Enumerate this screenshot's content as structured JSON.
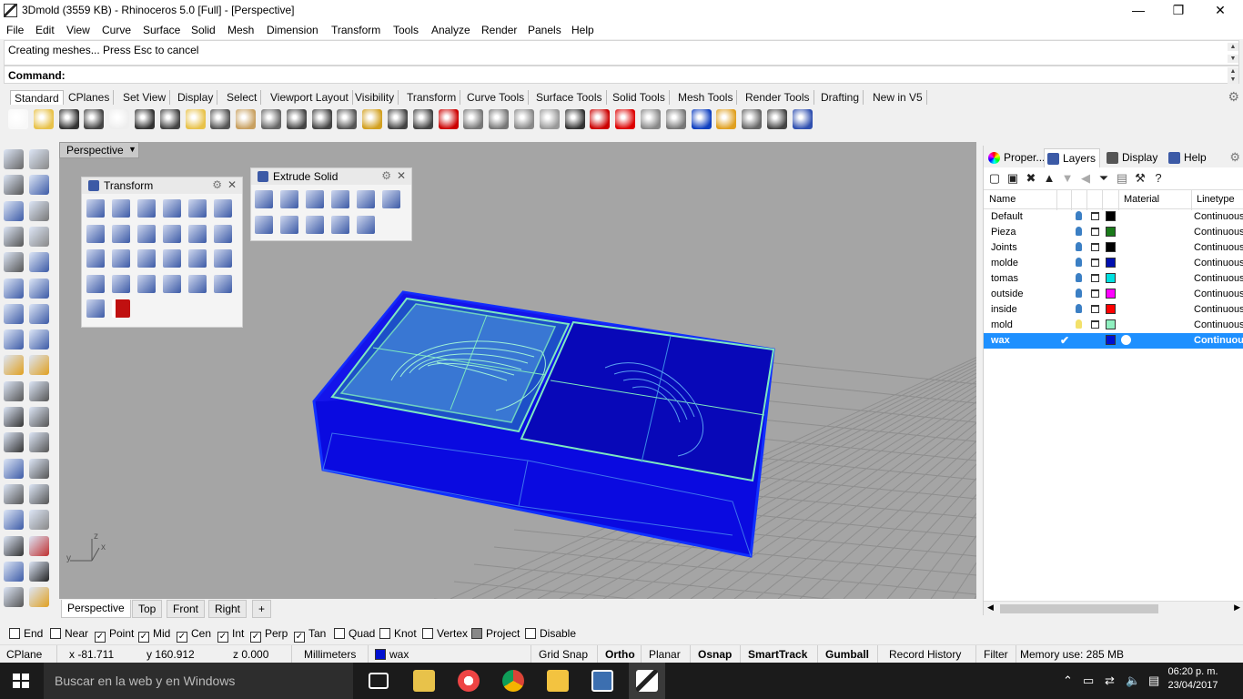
{
  "window": {
    "title": "3Dmold (3559 KB) - Rhinoceros 5.0 [Full] - [Perspective]",
    "minimize_glyph": "—",
    "restore_glyph": "❐",
    "close_glyph": "✕"
  },
  "menu": [
    "File",
    "Edit",
    "View",
    "Curve",
    "Surface",
    "Solid",
    "Mesh",
    "Dimension",
    "Transform",
    "Tools",
    "Analyze",
    "Render",
    "Panels",
    "Help"
  ],
  "command": {
    "history": "Creating meshes... Press Esc to cancel",
    "prompt": "Command:"
  },
  "toolbar_tabs": [
    "Standard",
    "CPlanes",
    "Set View",
    "Display",
    "Select",
    "Viewport Layout",
    "Visibility",
    "Transform",
    "Curve Tools",
    "Surface Tools",
    "Solid Tools",
    "Mesh Tools",
    "Render Tools",
    "Drafting",
    "New in V5"
  ],
  "standard_icons": [
    "new-icon",
    "open-icon",
    "save-icon",
    "print-icon",
    "import-icon",
    "cut-icon",
    "copy-icon",
    "paste-icon",
    "undo-icon",
    "pan-icon",
    "move-view-icon",
    "zoom-icon",
    "zoom-window-icon",
    "zoom-extents-icon",
    "zoom-selected-icon",
    "rotate-view-icon",
    "four-views-icon",
    "car-icon",
    "cplane-icon",
    "snap-icon",
    "points-icon",
    "light-icon",
    "lock-icon",
    "layer-color-icon",
    "color-wheel-icon",
    "shaded-sphere-icon",
    "rendered-sphere-icon",
    "blue-sphere-icon",
    "render-icon",
    "settings-icon",
    "options-icon",
    "help-icon"
  ],
  "viewport": {
    "name": "Perspective",
    "dropdown": "▼",
    "axes": {
      "x": "x",
      "y": "y",
      "z": "z"
    }
  },
  "transform_panel": {
    "title": "Transform"
  },
  "extrude_panel": {
    "title": "Extrude Solid"
  },
  "view_tabs": [
    "Perspective",
    "Top",
    "Front",
    "Right"
  ],
  "view_tab_add": "+",
  "panel_tabs": [
    "Proper...",
    "Layers",
    "Display",
    "Help"
  ],
  "layers": {
    "columns": {
      "name": "Name",
      "material": "Material",
      "linetype": "Linetype"
    },
    "rows": [
      {
        "name": "Default",
        "color": "#000000",
        "linetype": "Continuous"
      },
      {
        "name": "Pieza",
        "color": "#1a7a1a",
        "linetype": "Continuous"
      },
      {
        "name": "Joints",
        "color": "#000000",
        "linetype": "Continuous"
      },
      {
        "name": "molde",
        "color": "#0010b0",
        "linetype": "Continuous"
      },
      {
        "name": "tomas",
        "color": "#00e0e0",
        "linetype": "Continuous"
      },
      {
        "name": "outside",
        "color": "#ff00ff",
        "linetype": "Continuous"
      },
      {
        "name": "inside",
        "color": "#ff0000",
        "linetype": "Continuous"
      },
      {
        "name": "mold",
        "color": "#90f0c0",
        "linetype": "Continuous"
      },
      {
        "name": "wax",
        "color": "#0010d0",
        "linetype": "Continuous",
        "selected": true,
        "current": "✔"
      }
    ]
  },
  "osnaps": [
    {
      "label": "End",
      "checked": false
    },
    {
      "label": "Near",
      "checked": false
    },
    {
      "label": "Point",
      "checked": true
    },
    {
      "label": "Mid",
      "checked": true
    },
    {
      "label": "Cen",
      "checked": true
    },
    {
      "label": "Int",
      "checked": true
    },
    {
      "label": "Perp",
      "checked": true
    },
    {
      "label": "Tan",
      "checked": true
    },
    {
      "label": "Quad",
      "checked": false
    },
    {
      "label": "Knot",
      "checked": false
    },
    {
      "label": "Vertex",
      "checked": false
    },
    {
      "label": "Project",
      "checked": "partial"
    },
    {
      "label": "Disable",
      "checked": false
    }
  ],
  "status": {
    "cplane": "CPlane",
    "x": "x -81.711",
    "y": "y 160.912",
    "z": "z 0.000",
    "units": "Millimeters",
    "layer": "wax",
    "layer_color": "#0010d0",
    "grid_snap": "Grid Snap",
    "ortho": "Ortho",
    "planar": "Planar",
    "osnap": "Osnap",
    "smarttrack": "SmartTrack",
    "gumball": "Gumball",
    "record_history": "Record History",
    "filter": "Filter",
    "memory": "Memory use: 285 MB"
  },
  "taskbar": {
    "search_placeholder": "Buscar en la web y en Windows",
    "time": "06:20 p. m.",
    "date": "23/04/2017"
  },
  "colors": {
    "accent_blue": "#1e90ff",
    "mold_blue": "#0a12d8",
    "mold_green": "#7de8c0"
  }
}
